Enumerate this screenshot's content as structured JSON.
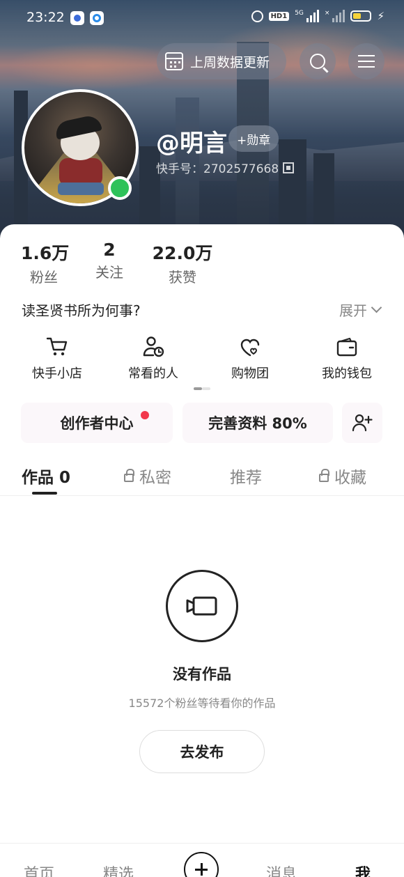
{
  "status_bar": {
    "time": "23:22",
    "hd_label": "HD1",
    "net_label": "5G",
    "x_label": "×"
  },
  "header": {
    "data_pill_label": "上周数据更新",
    "badge_label": "+勋章"
  },
  "profile": {
    "username": "@明言",
    "ks_id_label": "快手号：2702577668",
    "online": true
  },
  "stats": [
    {
      "value": "1.6万",
      "label": "粉丝"
    },
    {
      "value": "2",
      "label": "关注"
    },
    {
      "value": "22.0万",
      "label": "获赞"
    }
  ],
  "bio": {
    "text": "读圣贤书所为何事?",
    "expand_label": "展开"
  },
  "shortcuts": [
    {
      "label": "快手小店",
      "icon": "cart-icon"
    },
    {
      "label": "常看的人",
      "icon": "person-clock-icon"
    },
    {
      "label": "购物团",
      "icon": "heart-bag-icon"
    },
    {
      "label": "我的钱包",
      "icon": "wallet-icon"
    }
  ],
  "cards": {
    "creator": "创作者中心",
    "profile_completion": "完善资料 80%"
  },
  "tabs": [
    {
      "label": "作品 0",
      "active": true
    },
    {
      "label": "私密",
      "locked": true
    },
    {
      "label": "推荐"
    },
    {
      "label": "收藏",
      "locked": true
    }
  ],
  "empty_state": {
    "title": "没有作品",
    "subtitle": "15572个粉丝等待看你的作品",
    "button": "去发布"
  },
  "bottom_nav": {
    "home": "首页",
    "featured": "精选",
    "messages": "消息",
    "me": "我"
  },
  "colors": {
    "online": "#2ec25a",
    "notification_dot": "#f2384c",
    "card_bg": "#fbf7fa"
  }
}
